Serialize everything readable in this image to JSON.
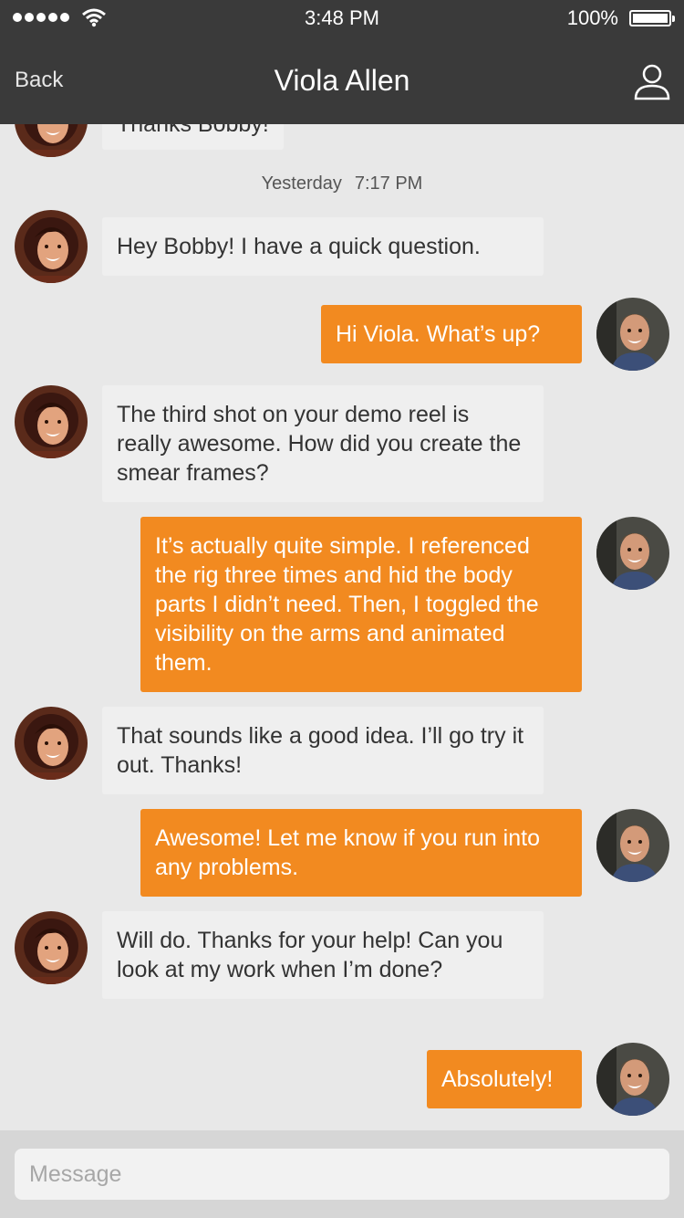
{
  "status_bar": {
    "time": "3:48 PM",
    "battery_percent": "100%",
    "signal_bars": 5,
    "icons": [
      "signal-dots-icon",
      "wifi-icon",
      "battery-icon"
    ]
  },
  "nav": {
    "back_label": "Back",
    "title": "Viola Allen",
    "right_icon": "profile-icon"
  },
  "conversation": {
    "partial_message": "Thanks Bobby!",
    "date_label": "Yesterday",
    "date_time": "7:17 PM",
    "messages": [
      {
        "from": "Viola",
        "text": "Hey Bobby! I have a quick question."
      },
      {
        "from": "Bobby",
        "text": "Hi Viola. What’s up?"
      },
      {
        "from": "Viola",
        "text": "The third shot on your demo reel is really awesome. How did you create the smear frames?"
      },
      {
        "from": "Bobby",
        "text": "It’s actually quite simple. I referenced the rig three times and hid the body parts I didn’t need. Then, I toggled the visibility on the arms and animated them."
      },
      {
        "from": "Viola",
        "text": "That sounds like a good idea. I’ll go try it out. Thanks!"
      },
      {
        "from": "Bobby",
        "text": "Awesome! Let me know if you run into any problems."
      },
      {
        "from": "Viola",
        "text": "Will do. Thanks for your help! Can you look at my work when I’m done?"
      },
      {
        "from": "Bobby",
        "text": "Absolutely!"
      }
    ]
  },
  "composer": {
    "placeholder": "Message",
    "value": ""
  },
  "colors": {
    "bar_background": "#3a3a3a",
    "outgoing_bubble": "#f28a20",
    "incoming_bubble": "#efefef",
    "chat_background": "#e8e8e8"
  }
}
